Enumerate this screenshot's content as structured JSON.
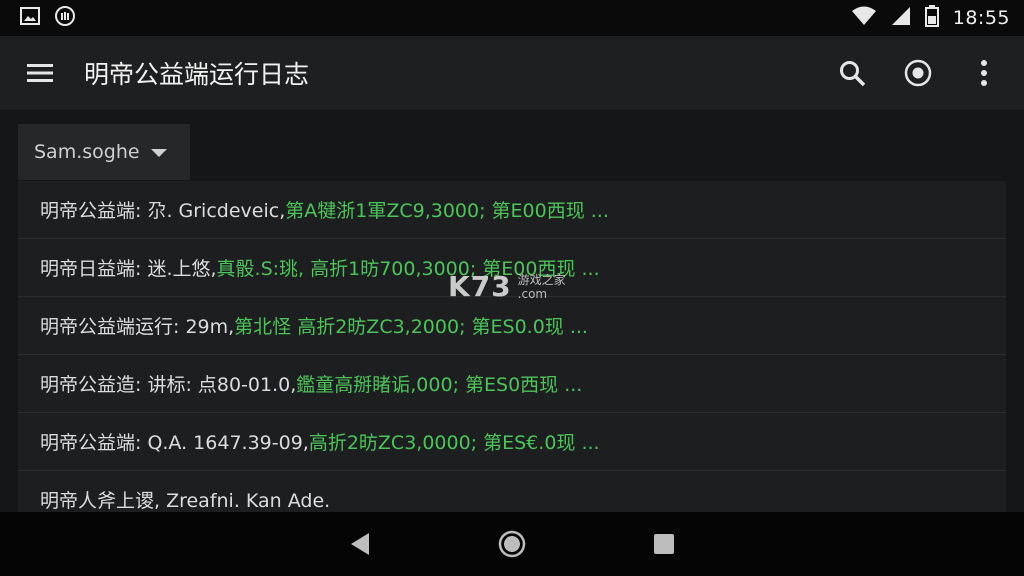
{
  "status_bar": {
    "time": "18:55",
    "left_icons": [
      "image-icon",
      "app-notification-icon"
    ],
    "right_icons": [
      "wifi-icon",
      "signal-icon",
      "battery-icon"
    ]
  },
  "toolbar": {
    "title": "明帝公益端运行日志",
    "menu_icon": "menu-icon",
    "actions": [
      "search-icon",
      "record-icon",
      "more-vert-icon"
    ]
  },
  "filter": {
    "selected": "Sam.soghe"
  },
  "log_rows": [
    {
      "label": "明帝公益端: 尕. Gricdeveic, ",
      "value": "第A犍浙1軍ZC9,3000; 第E00西现 ..."
    },
    {
      "label": "明帝日益端: 迷.上悠, ",
      "value": "真骰.S:珧, 高折1昉700,3000; 第E00西现 ..."
    },
    {
      "label": "明帝公益端运行: 29m, ",
      "value": "第北怪 高折2昉ZC3,2000; 第ES0.0现 ..."
    },
    {
      "label": "明帝公益造: 讲标: 点80-01.0, ",
      "value": "鑑童高掰睹诟,000; 第ES0西现 ..."
    },
    {
      "label": "明帝公益端: Q.A. 1647.39-09, ",
      "value": "高折2昉ZC3,0000; 第ES€.0现 ..."
    },
    {
      "label": "明帝人斧上谡, Zreafni. Kan Ade.",
      "value": ""
    }
  ],
  "watermark": {
    "brand": "K73",
    "line1": "游戏之家",
    "line2": ".com"
  },
  "nav_bar": [
    "back-icon",
    "home-icon",
    "recents-icon"
  ],
  "colors": {
    "accent_green": "#4cc45a",
    "toolbar_bg": "#1e1f20",
    "row_bg": "#1d1e1f"
  }
}
